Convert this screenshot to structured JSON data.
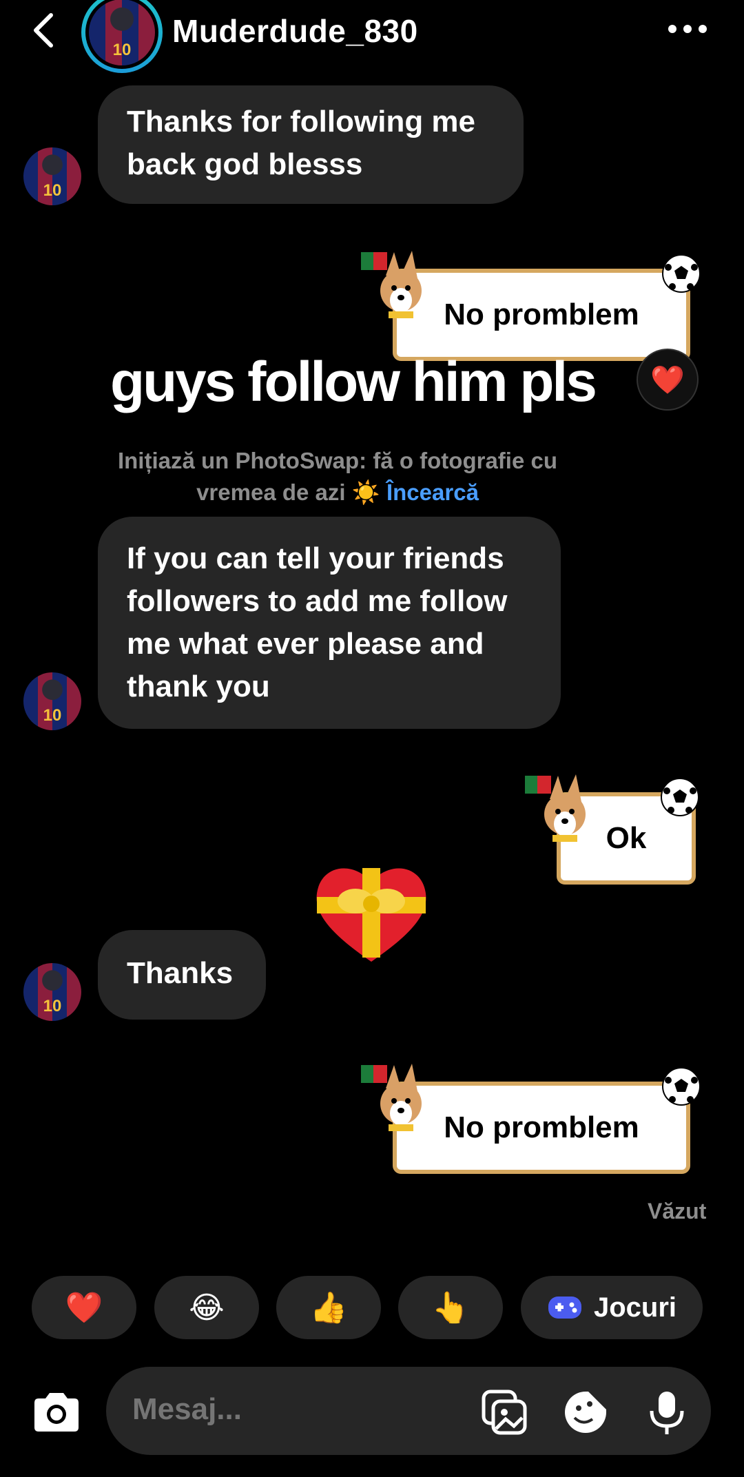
{
  "header": {
    "username": "Muderdude_830",
    "jersey_number": "10"
  },
  "messages": [
    {
      "from": "them",
      "lines": [
        "Thanks for following me",
        "back god blesss"
      ]
    },
    {
      "from": "me",
      "sticker_text": "No promblem"
    },
    {
      "from": "them",
      "lines": [
        "If you can tell your friends",
        "followers to add me follow",
        "me what ever please and",
        "thank you"
      ]
    },
    {
      "from": "me",
      "sticker_text": "Ok"
    },
    {
      "from": "them",
      "lines": [
        "Thanks"
      ]
    },
    {
      "from": "me",
      "sticker_text": "No promblem"
    }
  ],
  "overlay_caption": "guys follow him pls",
  "reaction": "❤️",
  "system_prompt": {
    "text": "Inițiază un PhotoSwap: fă o fotografie cu vremea de azi ☀️",
    "line1": "Inițiază un PhotoSwap: fă o fotografie cu",
    "line2": "vremea de azi ☀️",
    "link": "Încearcă"
  },
  "gift_emoji": "❤️🎀",
  "seen_label": "Văzut",
  "quick_replies": [
    "❤️",
    "😂",
    "👍",
    "👆"
  ],
  "games_label": "Jocuri",
  "composer": {
    "placeholder": "Mesaj..."
  },
  "colors": {
    "bubble": "#262626",
    "link": "#4a9eff",
    "sticker_border": "#d5a75f",
    "story_ring": "#1ec8c8"
  }
}
